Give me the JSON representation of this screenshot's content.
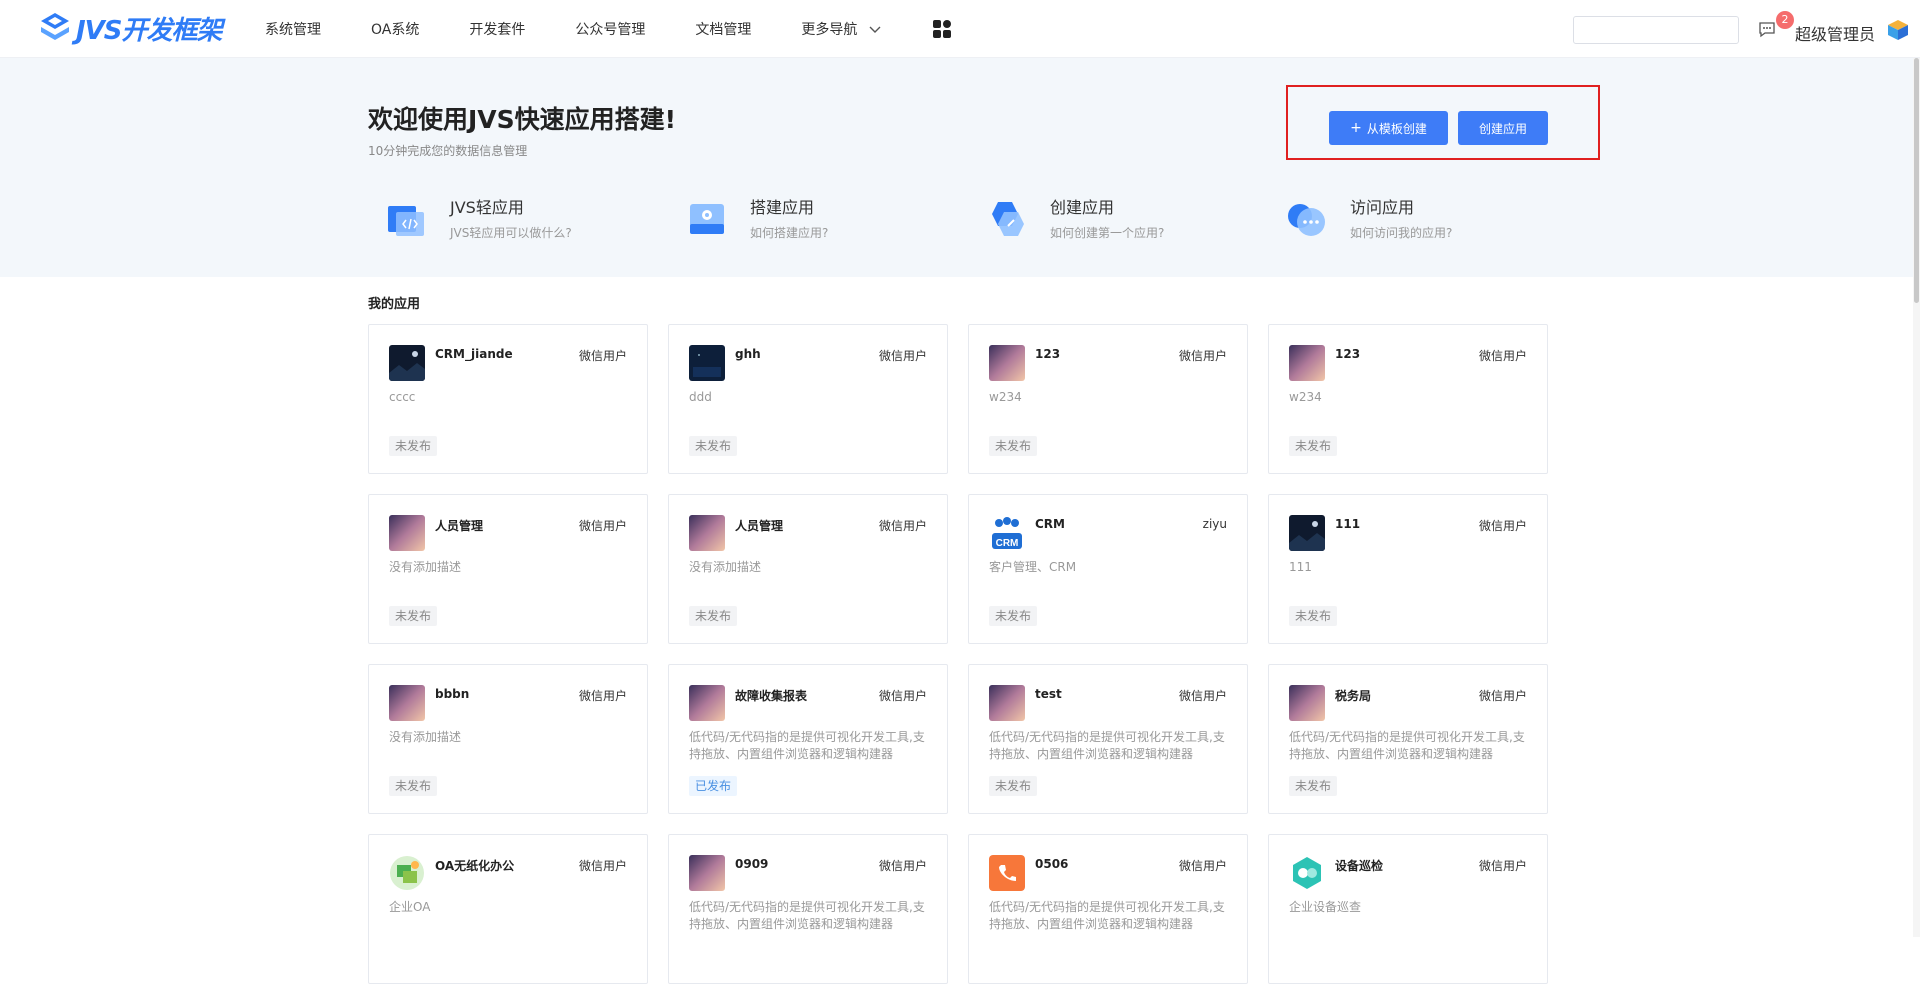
{
  "brand": {
    "name": "JVS开发框架"
  },
  "nav": {
    "items": [
      "系统管理",
      "OA系统",
      "开发套件",
      "公众号管理",
      "文档管理",
      "更多导航"
    ]
  },
  "header": {
    "search_placeholder": "",
    "message_count": "2",
    "user_name": "超级管理员"
  },
  "hero": {
    "title": "欢迎使用JVS快速应用搭建!",
    "subtitle": "10分钟完成您的数据信息管理",
    "btn_template_label": "从模板创建",
    "btn_create_label": "创建应用",
    "features": [
      {
        "title": "JVS轻应用",
        "desc": "JVS轻应用可以做什么?",
        "icon": "code-window-icon"
      },
      {
        "title": "搭建应用",
        "desc": "如何搭建应用?",
        "icon": "monitor-gear-icon"
      },
      {
        "title": "创建应用",
        "desc": "如何创建第一个应用?",
        "icon": "hexagon-link-icon"
      },
      {
        "title": "访问应用",
        "desc": "如何访问我的应用?",
        "icon": "chat-bubble-icon"
      }
    ]
  },
  "apps": {
    "section_title": "我的应用",
    "items": [
      {
        "name": "CRM_jiande",
        "owner": "微信用户",
        "desc": "cccc",
        "status": "未发布",
        "icon": "dark-night-icon"
      },
      {
        "name": "ghh",
        "owner": "微信用户",
        "desc": "ddd",
        "status": "未发布",
        "icon": "dark-blue-icon"
      },
      {
        "name": "123",
        "owner": "微信用户",
        "desc": "w234",
        "status": "未发布",
        "icon": "gradient-icon"
      },
      {
        "name": "123",
        "owner": "微信用户",
        "desc": "w234",
        "status": "未发布",
        "icon": "gradient-icon"
      },
      {
        "name": "人员管理",
        "owner": "微信用户",
        "desc": "没有添加描述",
        "status": "未发布",
        "icon": "gradient-icon"
      },
      {
        "name": "人员管理",
        "owner": "微信用户",
        "desc": "没有添加描述",
        "status": "未发布",
        "icon": "gradient-icon"
      },
      {
        "name": "CRM",
        "owner": "ziyu",
        "desc": "客户管理、CRM",
        "status": "未发布",
        "icon": "crm-people-icon"
      },
      {
        "name": "111",
        "owner": "微信用户",
        "desc": "111",
        "status": "未发布",
        "icon": "dark-night-icon"
      },
      {
        "name": "bbbn",
        "owner": "微信用户",
        "desc": "没有添加描述",
        "status": "未发布",
        "icon": "gradient-icon"
      },
      {
        "name": "故障收集报表",
        "owner": "微信用户",
        "desc": "低代码/无代码指的是提供可视化开发工具,支持拖放、内置组件浏览器和逻辑构建器",
        "status": "已发布",
        "icon": "gradient-icon"
      },
      {
        "name": "test",
        "owner": "微信用户",
        "desc": "低代码/无代码指的是提供可视化开发工具,支持拖放、内置组件浏览器和逻辑构建器",
        "status": "未发布",
        "icon": "gradient-icon"
      },
      {
        "name": "税务局",
        "owner": "微信用户",
        "desc": "低代码/无代码指的是提供可视化开发工具,支持拖放、内置组件浏览器和逻辑构建器",
        "status": "未发布",
        "icon": "gradient-icon"
      },
      {
        "name": "OA无纸化办公",
        "owner": "微信用户",
        "desc": "企业OA",
        "status": "",
        "icon": "oa-office-icon"
      },
      {
        "name": "0909",
        "owner": "微信用户",
        "desc": "低代码/无代码指的是提供可视化开发工具,支持拖放、内置组件浏览器和逻辑构建器",
        "status": "",
        "icon": "gradient-icon"
      },
      {
        "name": "0506",
        "owner": "微信用户",
        "desc": "低代码/无代码指的是提供可视化开发工具,支持拖放、内置组件浏览器和逻辑构建器",
        "status": "",
        "icon": "orange-phone-icon"
      },
      {
        "name": "设备巡检",
        "owner": "微信用户",
        "desc": "企业设备巡查",
        "status": "",
        "icon": "teal-device-icon"
      }
    ]
  },
  "colors": {
    "primary": "#3e7cf7",
    "highlight": "#e02020",
    "hero_bg": "#f3f7fb",
    "badge": "#f56c6c"
  }
}
